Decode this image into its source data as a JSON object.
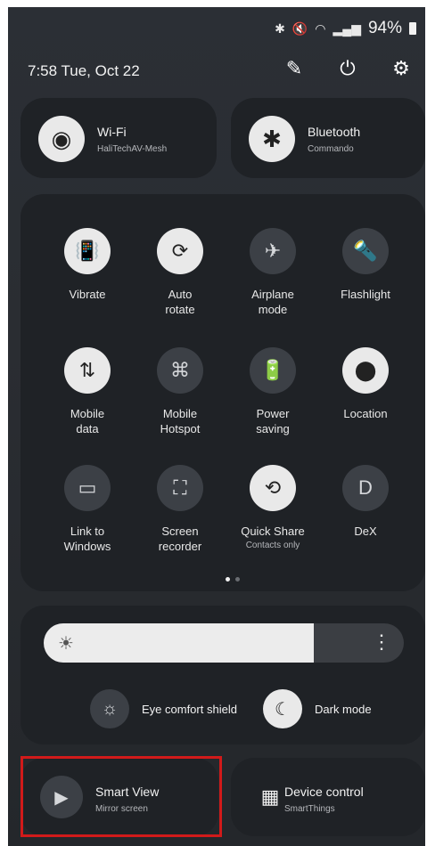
{
  "status": {
    "battery_pct": "94%",
    "icons": [
      "bluetooth-icon",
      "mute-icon",
      "wifi-6-icon",
      "signal-icon"
    ]
  },
  "header": {
    "datetime": "7:58  Tue, Oct 22",
    "actions": [
      "edit-icon",
      "power-icon",
      "settings-icon"
    ]
  },
  "wifi": {
    "title": "Wi-Fi",
    "sub": "HaliTechAV-Mesh"
  },
  "bluetooth": {
    "title": "Bluetooth",
    "sub": "Commando"
  },
  "tiles": [
    {
      "label": "Vibrate",
      "icon": "vibrate-icon",
      "on": true
    },
    {
      "label": "Auto\nrotate",
      "icon": "auto-rotate-icon",
      "on": true
    },
    {
      "label": "Airplane\nmode",
      "icon": "airplane-icon",
      "on": false
    },
    {
      "label": "Flashlight",
      "icon": "flashlight-icon",
      "on": false
    },
    {
      "label": "Mobile\ndata",
      "icon": "mobile-data-icon",
      "on": true
    },
    {
      "label": "Mobile\nHotspot",
      "icon": "hotspot-icon",
      "on": false
    },
    {
      "label": "Power\nsaving",
      "icon": "power-saving-icon",
      "on": false
    },
    {
      "label": "Location",
      "icon": "location-icon",
      "on": true
    },
    {
      "label": "Link to\nWindows",
      "icon": "link-windows-icon",
      "on": false
    },
    {
      "label": "Screen\nrecorder",
      "icon": "screen-recorder-icon",
      "on": false
    },
    {
      "label": "Quick Share",
      "sub": "Contacts only",
      "icon": "quick-share-icon",
      "on": true
    },
    {
      "label": "DeX",
      "icon": "dex-icon",
      "on": false
    }
  ],
  "brightness": {
    "level": 0.75
  },
  "eye_comfort": {
    "label": "Eye comfort shield"
  },
  "dark_mode": {
    "label": "Dark mode"
  },
  "smart_view": {
    "title": "Smart View",
    "sub": "Mirror screen"
  },
  "device_control": {
    "title": "Device control",
    "sub": "SmartThings"
  },
  "colors": {
    "tile_bg": "#1f2226",
    "on_icon_bg": "#e9e9e9",
    "off_icon_bg": "#3c4046",
    "highlight": "#d11a1a"
  }
}
